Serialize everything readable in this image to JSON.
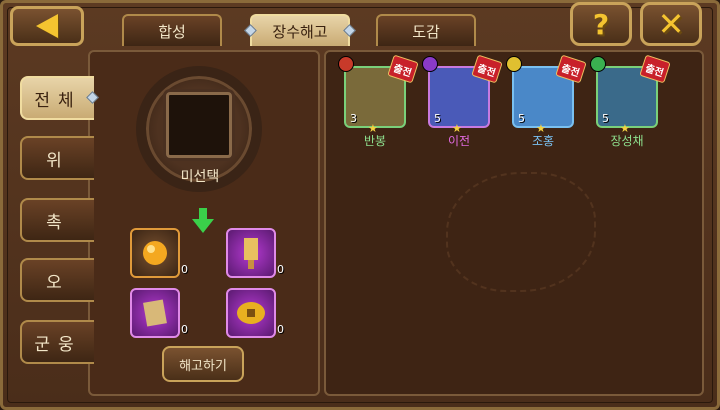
{
  "tabs": [
    {
      "label": "합성",
      "active": false
    },
    {
      "label": "장수해고",
      "active": true
    },
    {
      "label": "도감",
      "active": false
    }
  ],
  "side_tabs": [
    {
      "label": "전체",
      "active": true
    },
    {
      "label": "위",
      "active": false
    },
    {
      "label": "촉",
      "active": false
    },
    {
      "label": "오",
      "active": false
    },
    {
      "label": "군웅",
      "active": false
    }
  ],
  "slot_label": "미선택",
  "items": [
    {
      "name": "gold-orb",
      "count": "0",
      "style": "orange"
    },
    {
      "name": "purple-scroll",
      "count": "0",
      "style": "purple"
    },
    {
      "name": "parchment",
      "count": "0",
      "style": "purple"
    },
    {
      "name": "gold-coin",
      "count": "0",
      "style": "purple"
    }
  ],
  "dismiss_label": "해고하기",
  "heroes": [
    {
      "name": "반봉",
      "level": "3",
      "badge": "출전",
      "name_color": "#8ee08e",
      "class_color": "#c83a2a",
      "portrait": "#7a6a3a"
    },
    {
      "name": "이전",
      "level": "5",
      "badge": "출전",
      "name_color": "#e06ae0",
      "class_color": "#8a3ac8",
      "portrait": "#4a5ab8"
    },
    {
      "name": "조홍",
      "level": "5",
      "badge": "출전",
      "name_color": "#7ac0f0",
      "class_color": "#e0c030",
      "portrait": "#4a88c8"
    },
    {
      "name": "장성채",
      "level": "5",
      "badge": "출전",
      "name_color": "#8ee08e",
      "class_color": "#3ab050",
      "portrait": "#3a6a8a"
    }
  ],
  "colors": {
    "accent": "#f4c430",
    "panel": "#4a2b18"
  }
}
